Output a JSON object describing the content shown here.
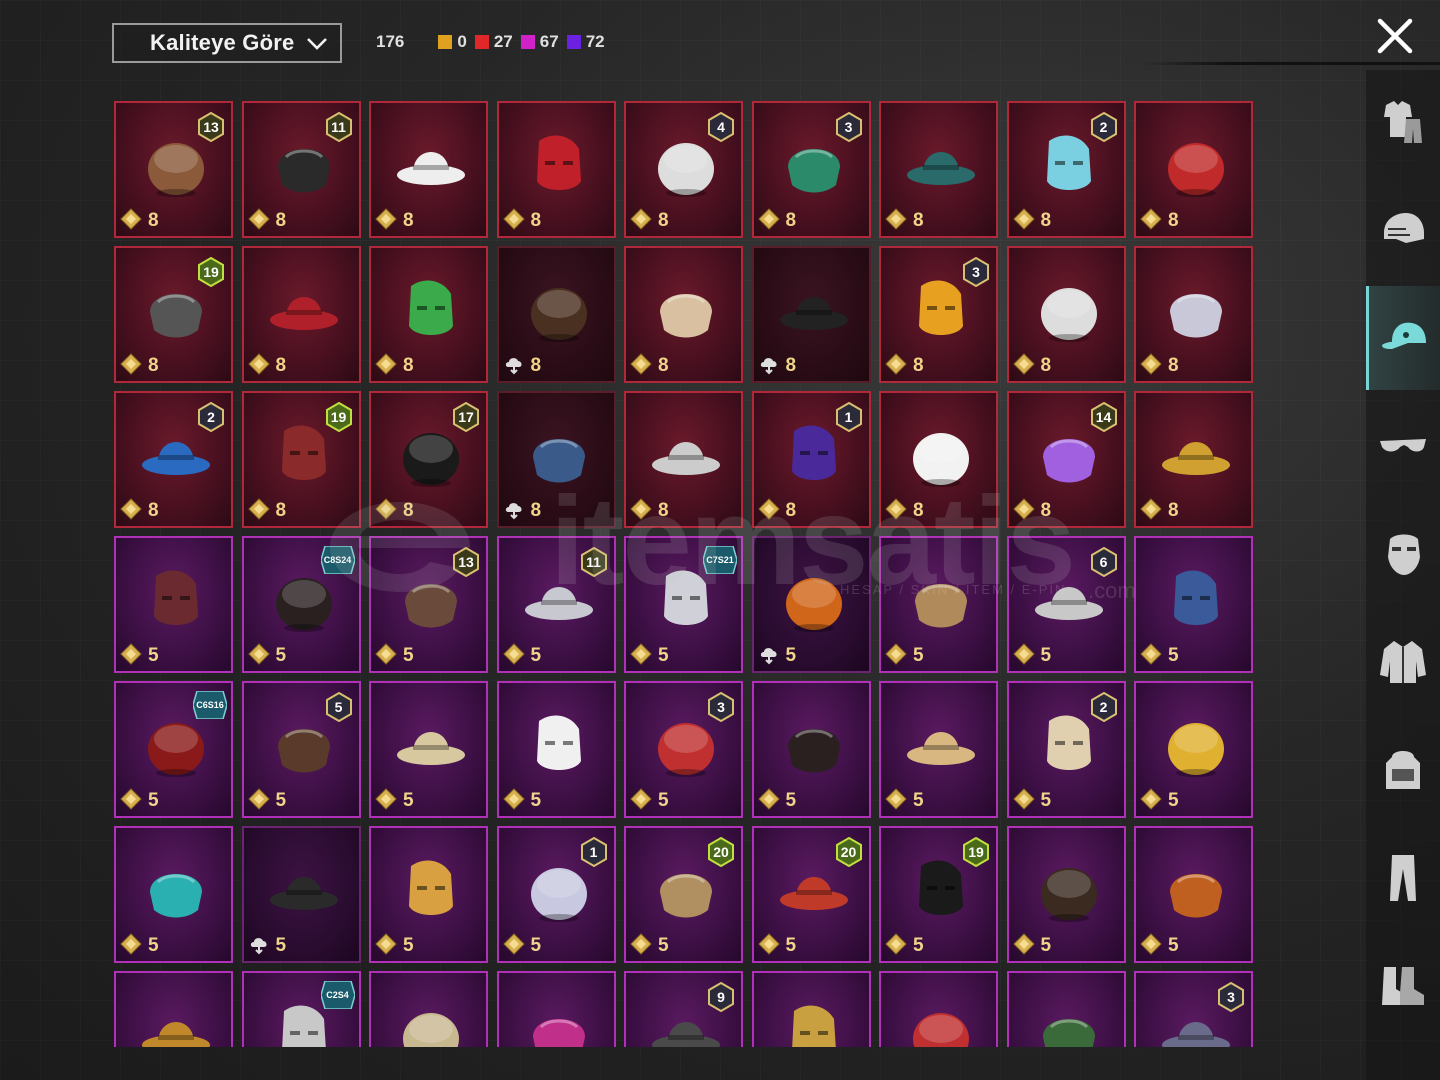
{
  "header": {
    "sort_label": "Kaliteye Göre",
    "total_count": "176",
    "quality_counts": [
      {
        "color": "#e0a020",
        "count": "0"
      },
      {
        "color": "#e02828",
        "count": "27"
      },
      {
        "color": "#d022c8",
        "count": "67"
      },
      {
        "color": "#6a22e0",
        "count": "72"
      }
    ]
  },
  "sidenav": {
    "items": [
      {
        "name": "outfit-icon",
        "active": false
      },
      {
        "name": "helmet-icon",
        "active": false
      },
      {
        "name": "cap-icon",
        "active": true
      },
      {
        "name": "glasses-icon",
        "active": false
      },
      {
        "name": "mask-icon",
        "active": false
      },
      {
        "name": "jacket-icon",
        "active": false
      },
      {
        "name": "backpack-icon",
        "active": false
      },
      {
        "name": "pants-icon",
        "active": false
      },
      {
        "name": "shoes-icon",
        "active": false
      }
    ]
  },
  "watermark": {
    "brand": "itemsatis",
    "tagline": "HESAP / SKIN / ITEM / E-PIN",
    "domain": ".com"
  },
  "items": [
    {
      "rarity": "red",
      "badge": "13",
      "badge_type": "level",
      "value": "8",
      "icon": "hat-feather-icon",
      "art_color": "#8a5a3a",
      "locked": false
    },
    {
      "rarity": "red",
      "badge": "11",
      "badge_type": "level",
      "value": "8",
      "icon": "black-hair-icon",
      "art_color": "#2a2a2a",
      "locked": false
    },
    {
      "rarity": "red",
      "badge": "",
      "badge_type": "",
      "value": "8",
      "icon": "white-cowboy-hat-icon",
      "art_color": "#eeeeee",
      "locked": false
    },
    {
      "rarity": "red",
      "badge": "",
      "badge_type": "",
      "value": "8",
      "icon": "red-helmet-icon",
      "art_color": "#c0202a",
      "locked": false
    },
    {
      "rarity": "red",
      "badge": "4",
      "badge_type": "level",
      "value": "8",
      "icon": "snowman-hat-icon",
      "art_color": "#dddddd",
      "locked": false
    },
    {
      "rarity": "red",
      "badge": "3",
      "badge_type": "level",
      "value": "8",
      "icon": "joker-mask-icon",
      "art_color": "#2a8a6a",
      "locked": false
    },
    {
      "rarity": "red",
      "badge": "",
      "badge_type": "",
      "value": "8",
      "icon": "teal-crest-helmet-icon",
      "art_color": "#2a6a6a",
      "locked": false
    },
    {
      "rarity": "red",
      "badge": "2",
      "badge_type": "level",
      "value": "8",
      "icon": "aqua-hat-icon",
      "art_color": "#7ad0e0",
      "locked": false
    },
    {
      "rarity": "red",
      "badge": "",
      "badge_type": "",
      "value": "8",
      "icon": "demon-mask-icon",
      "art_color": "#c02a2a",
      "locked": false
    },
    {
      "rarity": "red",
      "badge": "19",
      "badge_type": "level",
      "value": "8",
      "icon": "tactical-helmet-icon",
      "art_color": "#555555",
      "locked": false
    },
    {
      "rarity": "red",
      "badge": "",
      "badge_type": "",
      "value": "8",
      "icon": "red-gold-helmet-icon",
      "art_color": "#b0202a",
      "locked": false
    },
    {
      "rarity": "red",
      "badge": "",
      "badge_type": "",
      "value": "8",
      "icon": "green-leaf-mask-icon",
      "art_color": "#3aaa4a",
      "locked": false
    },
    {
      "rarity": "red",
      "badge": "",
      "badge_type": "",
      "value": "8",
      "icon": "brown-hair-icon",
      "art_color": "#4a3020",
      "locked": true
    },
    {
      "rarity": "red",
      "badge": "",
      "badge_type": "",
      "value": "8",
      "icon": "blonde-curls-icon",
      "art_color": "#d8c0a0",
      "locked": false
    },
    {
      "rarity": "red",
      "badge": "",
      "badge_type": "",
      "value": "8",
      "icon": "bat-helmet-icon",
      "art_color": "#222222",
      "locked": true
    },
    {
      "rarity": "red",
      "badge": "3",
      "badge_type": "level",
      "value": "8",
      "icon": "fries-hat-icon",
      "art_color": "#e8a020",
      "locked": false
    },
    {
      "rarity": "red",
      "badge": "",
      "badge_type": "",
      "value": "8",
      "icon": "white-mask-hair-icon",
      "art_color": "#dddddd",
      "locked": false
    },
    {
      "rarity": "red",
      "badge": "",
      "badge_type": "",
      "value": "8",
      "icon": "silver-wing-helmet-icon",
      "art_color": "#c8c8d8",
      "locked": false
    },
    {
      "rarity": "red",
      "badge": "2",
      "badge_type": "level",
      "value": "8",
      "icon": "blue-mech-helmet-icon",
      "art_color": "#2a6ac0",
      "locked": false
    },
    {
      "rarity": "red",
      "badge": "19",
      "badge_type": "level",
      "value": "8",
      "icon": "samurai-mask-icon",
      "art_color": "#8a2a2a",
      "locked": false
    },
    {
      "rarity": "red",
      "badge": "17",
      "badge_type": "level",
      "value": "8",
      "icon": "black-gold-helmet-icon",
      "art_color": "#1a1a1a",
      "locked": false
    },
    {
      "rarity": "red",
      "badge": "",
      "badge_type": "",
      "value": "8",
      "icon": "ice-crown-helmet-icon",
      "art_color": "#3a5a8a",
      "locked": true
    },
    {
      "rarity": "red",
      "badge": "",
      "badge_type": "",
      "value": "8",
      "icon": "horned-white-mask-icon",
      "art_color": "#cccccc",
      "locked": false
    },
    {
      "rarity": "red",
      "badge": "1",
      "badge_type": "level",
      "value": "8",
      "icon": "neon-helmet-icon",
      "art_color": "#4a2a9a",
      "locked": false
    },
    {
      "rarity": "red",
      "badge": "",
      "badge_type": "",
      "value": "8",
      "icon": "ghost-hood-icon",
      "art_color": "#f2f2f2",
      "locked": false
    },
    {
      "rarity": "red",
      "badge": "14",
      "badge_type": "level",
      "value": "8",
      "icon": "purple-crystal-hat-icon",
      "art_color": "#a060e0",
      "locked": false
    },
    {
      "rarity": "red",
      "badge": "",
      "badge_type": "",
      "value": "8",
      "icon": "gold-mech-helmet-icon",
      "art_color": "#d0a030",
      "locked": false
    },
    {
      "rarity": "purple",
      "badge": "",
      "badge_type": "",
      "value": "5",
      "icon": "auburn-hair-icon",
      "art_color": "#6a2a30",
      "locked": false
    },
    {
      "rarity": "purple",
      "badge": "C8S24",
      "badge_type": "season",
      "value": "5",
      "icon": "dark-bob-hair-icon",
      "art_color": "#2a2020",
      "locked": false
    },
    {
      "rarity": "purple",
      "badge": "13",
      "badge_type": "level",
      "value": "5",
      "icon": "goggles-hair-icon",
      "art_color": "#6a4a3a",
      "locked": false
    },
    {
      "rarity": "purple",
      "badge": "11",
      "badge_type": "level",
      "value": "5",
      "icon": "flower-silver-hair-icon",
      "art_color": "#c8c8d0",
      "locked": false
    },
    {
      "rarity": "purple",
      "badge": "C7S21",
      "badge_type": "season",
      "value": "5",
      "icon": "silver-swoop-hair-icon",
      "art_color": "#d0d0d8",
      "locked": false
    },
    {
      "rarity": "purple",
      "badge": "",
      "badge_type": "",
      "value": "5",
      "icon": "pumpkin-head-icon",
      "art_color": "#d0661a",
      "locked": true
    },
    {
      "rarity": "purple",
      "badge": "",
      "badge_type": "",
      "value": "5",
      "icon": "long-blonde-hair-icon",
      "art_color": "#b08a5a",
      "locked": false
    },
    {
      "rarity": "purple",
      "badge": "6",
      "badge_type": "level",
      "value": "5",
      "icon": "blade-mask-icon",
      "art_color": "#c8c8c8",
      "locked": false
    },
    {
      "rarity": "purple",
      "badge": "",
      "badge_type": "",
      "value": "5",
      "icon": "blue-turban-icon",
      "art_color": "#3a5a9a",
      "locked": false
    },
    {
      "rarity": "purple",
      "badge": "C6S16",
      "badge_type": "season",
      "value": "5",
      "icon": "red-hair-icon",
      "art_color": "#8a1a1a",
      "locked": false
    },
    {
      "rarity": "purple",
      "badge": "5",
      "badge_type": "level",
      "value": "5",
      "icon": "cat-ear-hair-icon",
      "art_color": "#5a3a2a",
      "locked": false
    },
    {
      "rarity": "purple",
      "badge": "",
      "badge_type": "",
      "value": "5",
      "icon": "blonde-headset-hair-icon",
      "art_color": "#d8c8a0",
      "locked": false
    },
    {
      "rarity": "purple",
      "badge": "",
      "badge_type": "",
      "value": "5",
      "icon": "polar-bear-head-icon",
      "art_color": "#f0f0f0",
      "locked": false
    },
    {
      "rarity": "purple",
      "badge": "3",
      "badge_type": "level",
      "value": "5",
      "icon": "jester-hat-icon",
      "art_color": "#c03030",
      "locked": false
    },
    {
      "rarity": "purple",
      "badge": "",
      "badge_type": "",
      "value": "5",
      "icon": "black-ribbon-hair-icon",
      "art_color": "#2a2020",
      "locked": false
    },
    {
      "rarity": "purple",
      "badge": "",
      "badge_type": "",
      "value": "5",
      "icon": "sun-hat-icon",
      "art_color": "#d8b880",
      "locked": false
    },
    {
      "rarity": "purple",
      "badge": "2",
      "badge_type": "level",
      "value": "5",
      "icon": "sailor-hat-hair-icon",
      "art_color": "#e0d0b0",
      "locked": false
    },
    {
      "rarity": "purple",
      "badge": "",
      "badge_type": "",
      "value": "5",
      "icon": "gold-visor-icon",
      "art_color": "#e0b030",
      "locked": false
    },
    {
      "rarity": "purple",
      "badge": "",
      "badge_type": "",
      "value": "5",
      "icon": "unicorn-hood-icon",
      "art_color": "#2ab0b0",
      "locked": false
    },
    {
      "rarity": "purple",
      "badge": "",
      "badge_type": "",
      "value": "5",
      "icon": "neon-city-hood-icon",
      "art_color": "#2a2a2a",
      "locked": true
    },
    {
      "rarity": "purple",
      "badge": "",
      "badge_type": "",
      "value": "5",
      "icon": "potato-head-icon",
      "art_color": "#d8a040",
      "locked": false
    },
    {
      "rarity": "purple",
      "badge": "1",
      "badge_type": "level",
      "value": "5",
      "icon": "pigtail-hair-icon",
      "art_color": "#c8c8e0",
      "locked": false
    },
    {
      "rarity": "purple",
      "badge": "20",
      "badge_type": "level",
      "value": "5",
      "icon": "bunny-ear-hair-icon",
      "art_color": "#b09060",
      "locked": false
    },
    {
      "rarity": "purple",
      "badge": "20",
      "badge_type": "level",
      "value": "5",
      "icon": "monkey-king-mask-icon",
      "art_color": "#c03a2a",
      "locked": false
    },
    {
      "rarity": "purple",
      "badge": "19",
      "badge_type": "level",
      "value": "5",
      "icon": "black-bun-hair-icon",
      "art_color": "#1a1a1a",
      "locked": false
    },
    {
      "rarity": "purple",
      "badge": "",
      "badge_type": "",
      "value": "5",
      "icon": "gold-band-hair-icon",
      "art_color": "#3a2a20",
      "locked": false
    },
    {
      "rarity": "purple",
      "badge": "",
      "badge_type": "",
      "value": "5",
      "icon": "orange-tiara-hair-icon",
      "art_color": "#c06020",
      "locked": false
    },
    {
      "rarity": "purple",
      "badge": "",
      "badge_type": "",
      "value": "",
      "icon": "bear-ear-mask-icon",
      "art_color": "#c0882a",
      "locked": false
    },
    {
      "rarity": "purple",
      "badge": "C2S4",
      "badge_type": "season",
      "value": "",
      "icon": "silver-comb-hair-icon",
      "art_color": "#c8c8c8",
      "locked": false
    },
    {
      "rarity": "purple",
      "badge": "",
      "badge_type": "",
      "value": "",
      "icon": "officer-cap-icon",
      "art_color": "#c8b890",
      "locked": false
    },
    {
      "rarity": "purple",
      "badge": "",
      "badge_type": "",
      "value": "",
      "icon": "pink-bow-icon",
      "art_color": "#c0308a",
      "locked": false
    },
    {
      "rarity": "purple",
      "badge": "9",
      "badge_type": "level",
      "value": "",
      "icon": "dark-helmet-icon",
      "art_color": "#4a4a4a",
      "locked": false
    },
    {
      "rarity": "purple",
      "badge": "",
      "badge_type": "",
      "value": "",
      "icon": "gold-crown-icon",
      "art_color": "#c8a040",
      "locked": false
    },
    {
      "rarity": "purple",
      "badge": "",
      "badge_type": "",
      "value": "",
      "icon": "red-brim-hat-icon",
      "art_color": "#c03030",
      "locked": false
    },
    {
      "rarity": "purple",
      "badge": "",
      "badge_type": "",
      "value": "",
      "icon": "green-mask-icon",
      "art_color": "#3a6a3a",
      "locked": false
    },
    {
      "rarity": "purple",
      "badge": "3",
      "badge_type": "level",
      "value": "",
      "icon": "ufo-hat-icon",
      "art_color": "#6a6a8a",
      "locked": false
    }
  ]
}
